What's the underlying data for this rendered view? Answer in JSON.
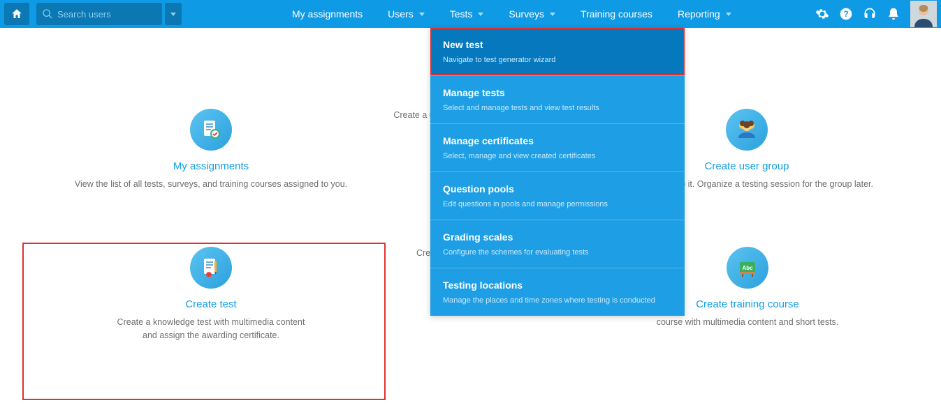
{
  "search": {
    "placeholder": "Search users"
  },
  "nav": {
    "items": [
      {
        "label": "My assignments",
        "dd": false
      },
      {
        "label": "Users",
        "dd": true
      },
      {
        "label": "Tests",
        "dd": true
      },
      {
        "label": "Surveys",
        "dd": true
      },
      {
        "label": "Training courses",
        "dd": false
      },
      {
        "label": "Reporting",
        "dd": true
      }
    ]
  },
  "dropdown": {
    "items": [
      {
        "title": "New test",
        "desc": "Navigate to test generator wizard"
      },
      {
        "title": "Manage tests",
        "desc": "Select and manage tests and view test results"
      },
      {
        "title": "Manage certificates",
        "desc": "Select, manage and view created certificates"
      },
      {
        "title": "Question pools",
        "desc": "Edit questions in pools and manage permissions"
      },
      {
        "title": "Grading scales",
        "desc": "Configure the schemes for evaluating tests"
      },
      {
        "title": "Testing locations",
        "desc": "Manage the places and time zones where testing is conducted"
      }
    ]
  },
  "cards": {
    "my_assignments": {
      "title": "My assignments",
      "desc": "View the list of all tests, surveys, and training courses assigned to you."
    },
    "create_user": {
      "title": "",
      "desc": "Create a user profile"
    },
    "user_group": {
      "title": "Create user group",
      "desc": "and add users to it. Organize a testing session for the group later."
    },
    "create_test": {
      "title": "Create test",
      "desc_line1": "Create a knowledge test with multimedia content",
      "desc_line2": "and assign the awarding certificate."
    },
    "create_survey": {
      "desc": "Create a"
    },
    "training": {
      "title": "Create training course",
      "desc": "course with multimedia content and short tests."
    }
  }
}
